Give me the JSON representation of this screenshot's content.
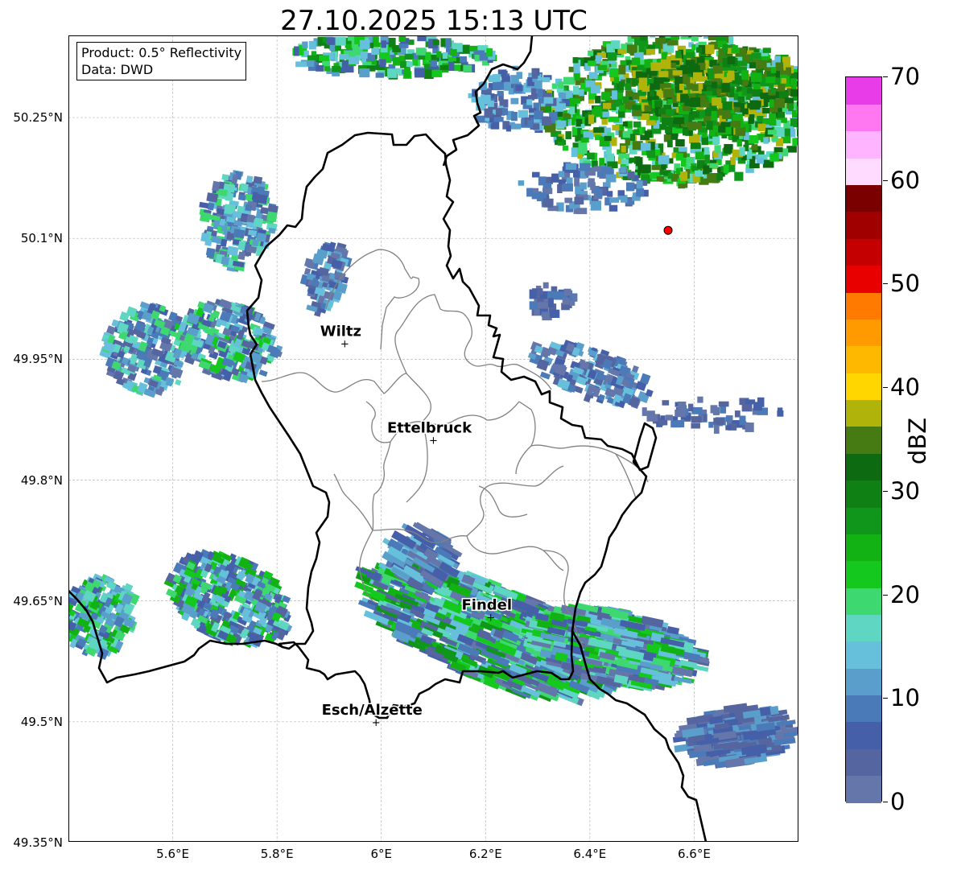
{
  "title": "27.10.2025 15:13 UTC",
  "info": {
    "line1": "Product: 0.5° Reflectivity",
    "line2": "Data: DWD"
  },
  "map": {
    "lon_range": [
      5.4,
      6.8
    ],
    "lat_range": [
      49.3,
      50.3
    ],
    "lat_ticks": [
      {
        "value": 50.25,
        "label": "50.25°N"
      },
      {
        "value": 50.1,
        "label": "50.1°N"
      },
      {
        "value": 49.95,
        "label": "49.95°N"
      },
      {
        "value": 49.8,
        "label": "49.8°N"
      },
      {
        "value": 49.65,
        "label": "49.65°N"
      },
      {
        "value": 49.5,
        "label": "49.5°N"
      },
      {
        "value": 49.35,
        "label": "49.35°N"
      }
    ],
    "lon_ticks": [
      {
        "value": 5.6,
        "label": "5.6°E"
      },
      {
        "value": 5.8,
        "label": "5.8°E"
      },
      {
        "value": 6.0,
        "label": "6°E"
      },
      {
        "value": 6.2,
        "label": "6.2°E"
      },
      {
        "value": 6.4,
        "label": "6.4°E"
      },
      {
        "value": 6.6,
        "label": "6.6°E"
      }
    ],
    "cities": [
      {
        "name": "Wiltz",
        "lon": 5.93,
        "lat": 49.97
      },
      {
        "name": "Ettelbruck",
        "lon": 6.1,
        "lat": 49.85
      },
      {
        "name": "Findel",
        "lon": 6.21,
        "lat": 49.63
      },
      {
        "name": "Esch/Alzette",
        "lon": 5.99,
        "lat": 49.5
      }
    ],
    "radar_site": {
      "lon": 6.55,
      "lat": 50.11,
      "color": "#ff0000"
    }
  },
  "colorbar": {
    "label": "dBZ",
    "min": 0,
    "max": 70,
    "ticks": [
      0,
      10,
      20,
      30,
      40,
      50,
      60,
      70
    ],
    "colors": [
      "#6577aa",
      "#5565a0",
      "#4560a8",
      "#4a7ab8",
      "#5a9fcc",
      "#66c0dc",
      "#5fd6c2",
      "#3ed870",
      "#14c81e",
      "#12b114",
      "#10961a",
      "#0e8014",
      "#0d6a10",
      "#467a12",
      "#afb30a",
      "#ffd600",
      "#ffb800",
      "#ff9a00",
      "#ff7a00",
      "#e80000",
      "#c40000",
      "#a00000",
      "#7a0000",
      "#ffdcff",
      "#ffb4ff",
      "#ff78f2",
      "#e83ce8"
    ]
  }
}
